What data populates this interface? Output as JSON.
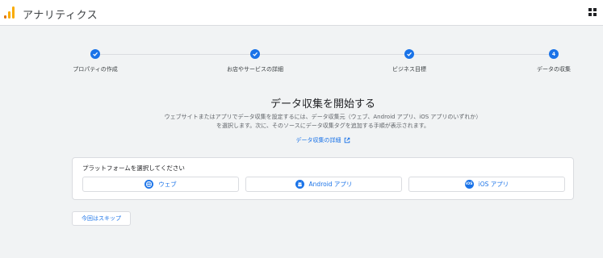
{
  "app": {
    "title": "アナリティクス"
  },
  "stepper": {
    "steps": [
      {
        "label": "プロパティの作成",
        "state": "done"
      },
      {
        "label": "お店やサービスの詳細",
        "state": "done"
      },
      {
        "label": "ビジネス目標",
        "state": "done"
      },
      {
        "label": "データの収集",
        "state": "current",
        "number": "4"
      }
    ]
  },
  "main": {
    "heading": "データ収集を開始する",
    "description_line1": "ウェブサイトまたはアプリでデータ収集を設定するには、データ収集元（ウェブ、Android アプリ、iOS アプリのいずれか）",
    "description_line2": "を選択します。次に、そのソースにデータ収集タグを追加する手順が表示されます。",
    "details_link": "データ収集の詳細"
  },
  "platform": {
    "title": "プラットフォームを選択してください",
    "options": [
      {
        "label": "ウェブ",
        "icon": "globe-icon"
      },
      {
        "label": "Android アプリ",
        "icon": "android-icon"
      },
      {
        "label": "iOS アプリ",
        "icon": "ios-icon",
        "icon_text": "iOS"
      }
    ]
  },
  "skip": {
    "label": "今回はスキップ"
  },
  "colors": {
    "accent": "#1a73e8",
    "background": "#f1f3f4",
    "logo_dark": "#e37400",
    "logo_light": "#f9ab00"
  }
}
